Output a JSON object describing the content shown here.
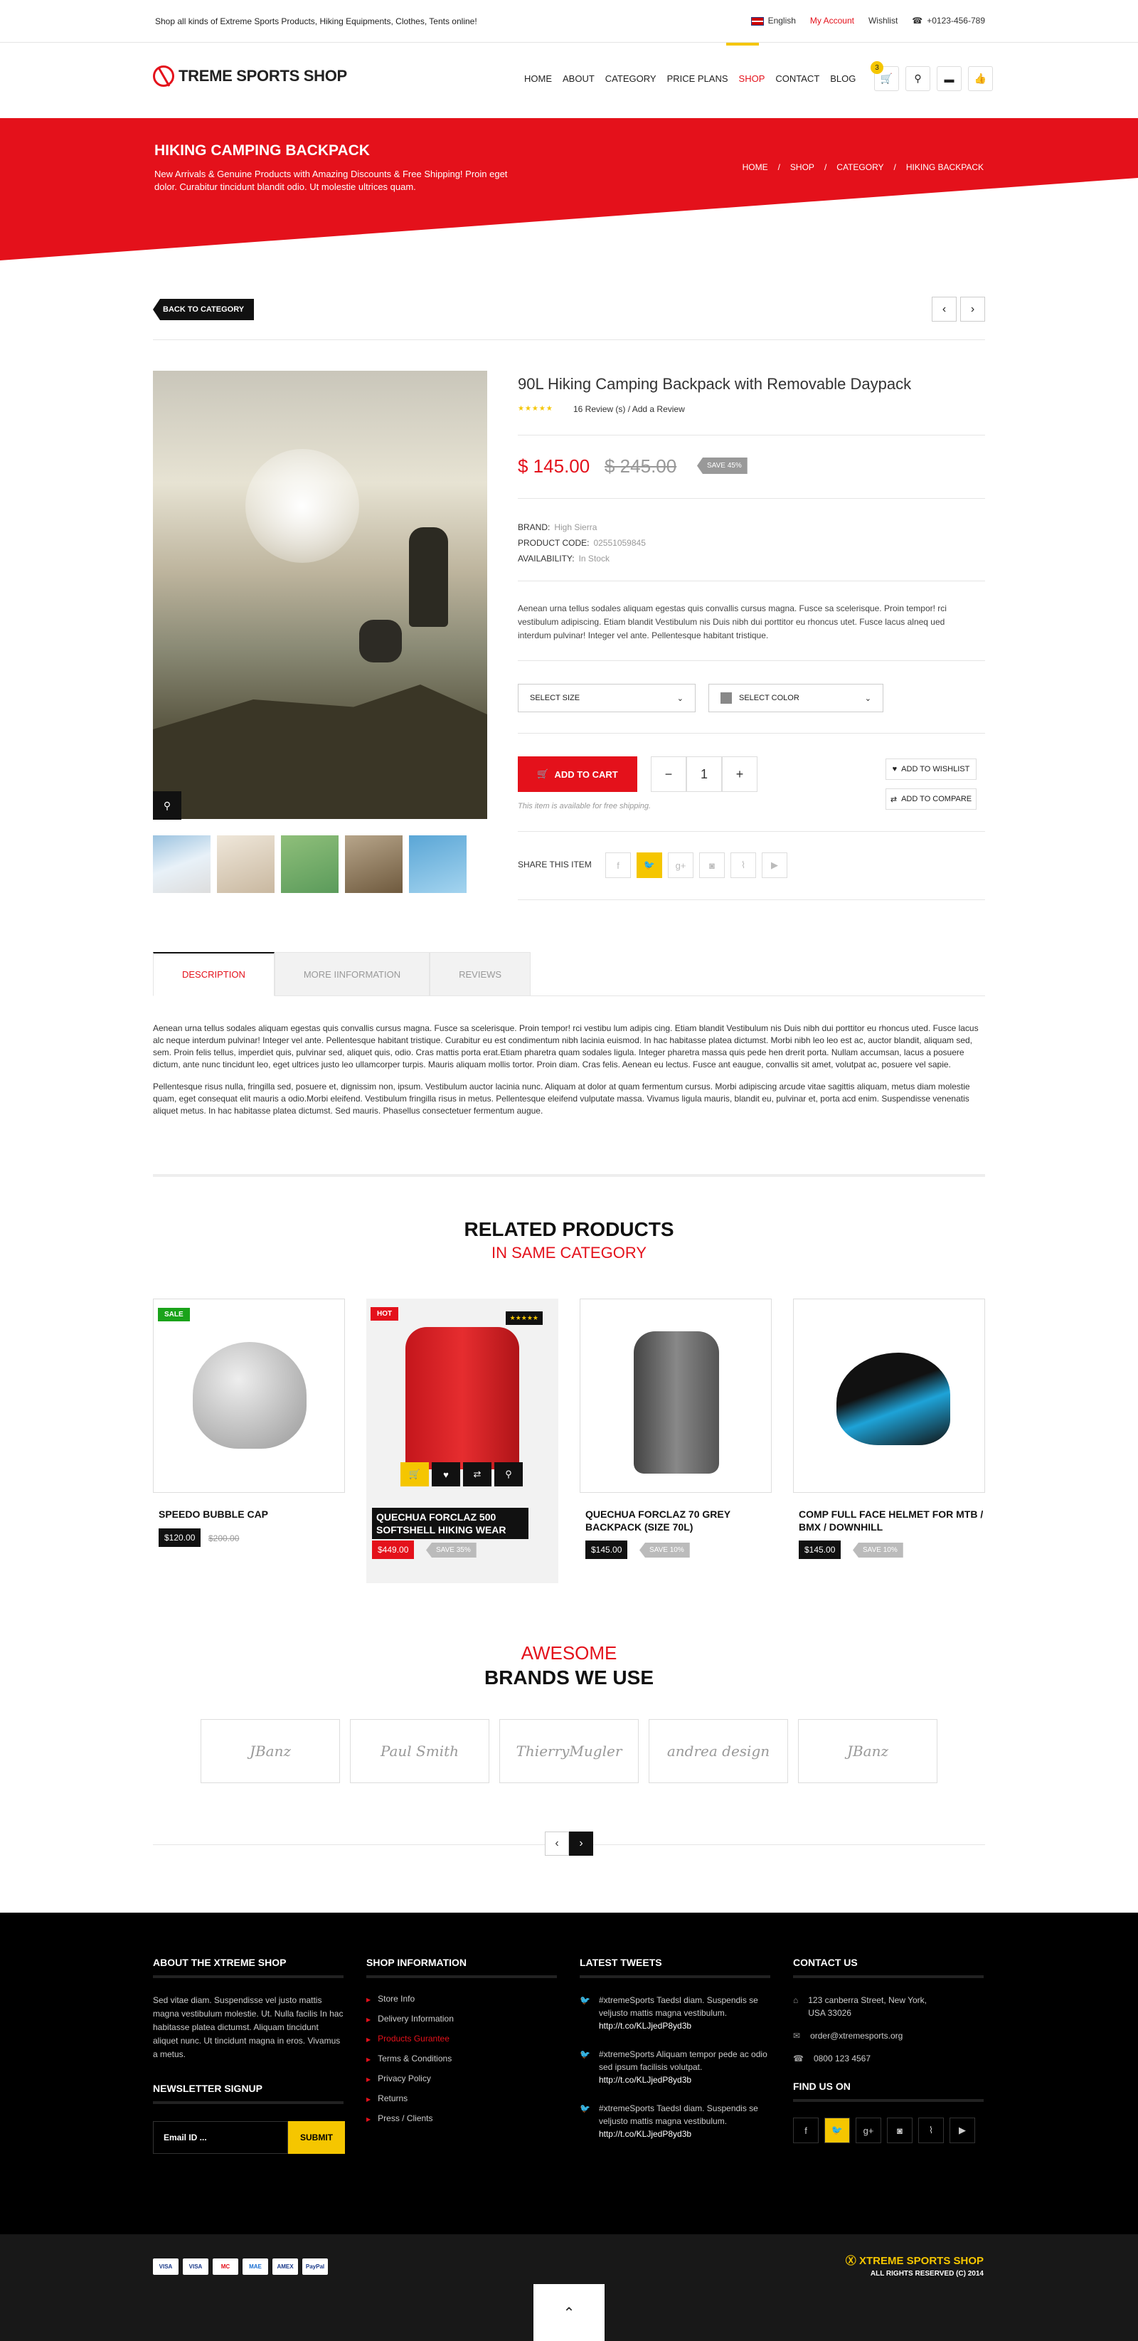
{
  "topbar": {
    "tagline": "Shop all kinds of Extreme Sports Products, Hiking Equipments, Clothes, Tents online!",
    "language": "English",
    "my_account": "My Account",
    "wishlist": "Wishlist",
    "phone": "+0123-456-789"
  },
  "header": {
    "logo": "TREME SPORTS SHOP",
    "nav": [
      "HOME",
      "ABOUT",
      "CATEGORY",
      "PRICE PLANS",
      "SHOP",
      "CONTACT",
      "BLOG"
    ],
    "active_nav": "SHOP",
    "cart_count": "3"
  },
  "banner": {
    "title": "HIKING CAMPING BACKPACK",
    "subtitle": "New Arrivals & Genuine Products with Amazing Discounts & Free Shipping! Proin eget dolor. Curabitur tincidunt blandit odio. Ut molestie ultrices quam.",
    "breadcrumb": [
      "HOME",
      "SHOP",
      "CATEGORY",
      "HIKING BACKPACK"
    ]
  },
  "back_label": "BACK TO CATEGORY",
  "product": {
    "title": "90L Hiking Camping Backpack with Removable Daypack",
    "rating": 5,
    "reviews": "16 Review (s)",
    "add_review": "Add a Review",
    "price": "$ 145.00",
    "old_price": "$ 245.00",
    "save": "SAVE 45%",
    "brand_label": "BRAND:",
    "brand": "High Sierra",
    "code_label": "PRODUCT CODE:",
    "code": "02551059845",
    "avail_label": "AVAILABILITY:",
    "availability": "In Stock",
    "description": "Aenean urna tellus sodales aliquam egestas quis convallis cursus magna. Fusce sa scelerisque. Proin tempor! rci vestibulum adipiscing. Etiam blandit Vestibulum nis Duis nibh dui porttitor eu rhoncus utet. Fusce lacus alneq ued interdum pulvinar! Integer vel ante. Pellentesque habitant tristique.",
    "select_size": "SELECT SIZE",
    "select_color": "SELECT COLOR",
    "add_to_cart": "ADD TO CART",
    "qty": "1",
    "minus": "−",
    "plus": "+",
    "free_shipping": "This item is available for free shipping.",
    "wishlist": "ADD TO WISHLIST",
    "compare": "ADD TO COMPARE",
    "share": "SHARE THIS ITEM"
  },
  "tabs": [
    "DESCRIPTION",
    "MORE IINFORMATION",
    "REVIEWS"
  ],
  "description": [
    "Aenean urna tellus sodales aliquam egestas quis convallis cursus magna. Fusce sa scelerisque. Proin tempor! rci vestibu lum adipis cing. Etiam blandit Vestibulum nis Duis nibh dui porttitor eu rhoncus uted. Fusce lacus alc neque interdum pulvinar! Integer vel ante. Pellentesque habitant tristique. Curabitur eu est condimentum nibh lacinia euismod. In hac habitasse platea dictumst. Morbi nibh leo leo est ac, auctor blandit, aliquam sed, sem. Proin felis tellus, imperdiet quis, pulvinar sed, aliquet quis, odio. Cras mattis porta erat.Etiam pharetra quam sodales ligula. Integer pharetra massa quis pede hen drerit porta. Nullam accumsan, lacus a posuere dictum, ante nunc tincidunt leo, eget ultrices justo leo ullamcorper turpis. Mauris aliquam mollis tortor. Proin diam. Cras felis. Aenean eu lectus. Fusce ant eaugue, convallis sit amet, volutpat ac, posuere vel sapie.",
    "Pellentesque risus nulla, fringilla sed, posuere et, dignissim non, ipsum. Vestibulum auctor lacinia nunc. Aliquam at dolor at quam fermentum cursus. Morbi adipiscing arcude vitae sagittis aliquam, metus diam molestie quam, eget consequat elit mauris a odio.Morbi eleifend. Vestibulum fringilla risus in metus. Pellentesque eleifend vulputate massa. Vivamus ligula mauris, blandit eu, pulvinar et, porta acd enim. Suspendisse venenatis aliquet metus. In hac habitasse platea dictumst. Sed mauris. Phasellus consectetuer fermentum augue."
  ],
  "related": {
    "title": "RELATED PRODUCTS",
    "subtitle": "IN SAME CATEGORY",
    "items": [
      {
        "name": "SPEEDO BUBBLE CAP",
        "price": "$120.00",
        "old": "$200.00",
        "badge": "SALE",
        "badge_color": "#1aa31a"
      },
      {
        "name": "QUECHUA FORCLAZ 500 SOFTSHELL HIKING WEAR",
        "price": "$449.00",
        "save": "SAVE 35%",
        "badge": "HOT",
        "badge_color": "#e4111b",
        "stars": "★★★★★"
      },
      {
        "name": "QUECHUA FORCLAZ 70 GREY BACKPACK (SIZE 70L)",
        "price": "$145.00",
        "save": "SAVE 10%"
      },
      {
        "name": "COMP FULL FACE HELMET FOR MTB / BMX / DOWNHILL",
        "price": "$145.00",
        "save": "SAVE 10%"
      }
    ]
  },
  "brands": {
    "title1": "AWESOME",
    "title2": "BRANDS WE USE",
    "items": [
      "JBanz",
      "Paul Smith",
      "ThierryMugler",
      "andrea design",
      "JBanz"
    ]
  },
  "footer": {
    "about_title": "ABOUT THE XTREME SHOP",
    "about_text": "Sed vitae diam. Suspendisse vel justo mattis magna vestibulum molestie. Ut. Nulla facilis In hac habitasse platea dictumst. Aliquam tincidunt aliquet nunc. Ut tincidunt magna in eros. Vivamus a metus.",
    "newsletter_title": "NEWSLETTER SIGNUP",
    "email_placeholder": "Email ID ...",
    "submit": "SUBMIT",
    "shop_title": "SHOP INFORMATION",
    "shop_links": [
      "Store Info",
      "Delivery Information",
      "Products Gurantee",
      "Terms & Conditions",
      "Privacy Policy",
      "Returns",
      "Press / Clients"
    ],
    "tweets_title": "LATEST TWEETS",
    "tweets": [
      {
        "text": "#xtremeSports Taedsl diam. Suspendis se veljusto mattis magna vestibulum.",
        "link": "http://t.co/KLJjedP8yd3b"
      },
      {
        "text": "#xtremeSports Aliquam tempor pede ac odio sed ipsum facilisis volutpat.",
        "link": "http://t.co/KLJjedP8yd3b"
      },
      {
        "text": "#xtremeSports Taedsl diam. Suspendis se veljusto mattis magna vestibulum.",
        "link": "http://t.co/KLJjedP8yd3b"
      }
    ],
    "contact_title": "CONTACT US",
    "address": "123 canberra Street, New York, USA 33026",
    "email": "order@xtremesports.org",
    "phone": "0800 123 4567",
    "find_title": "FIND US ON",
    "brand": "XTREME SPORTS SHOP",
    "copyright": "ALL RIGHTS RESERVED (C) 2014",
    "cards": [
      "VISA",
      "VISA",
      "MC",
      "MAE",
      "AMEX",
      "PayPal"
    ]
  },
  "colors": {
    "accent": "#e4111b",
    "yellow": "#f5c600"
  }
}
